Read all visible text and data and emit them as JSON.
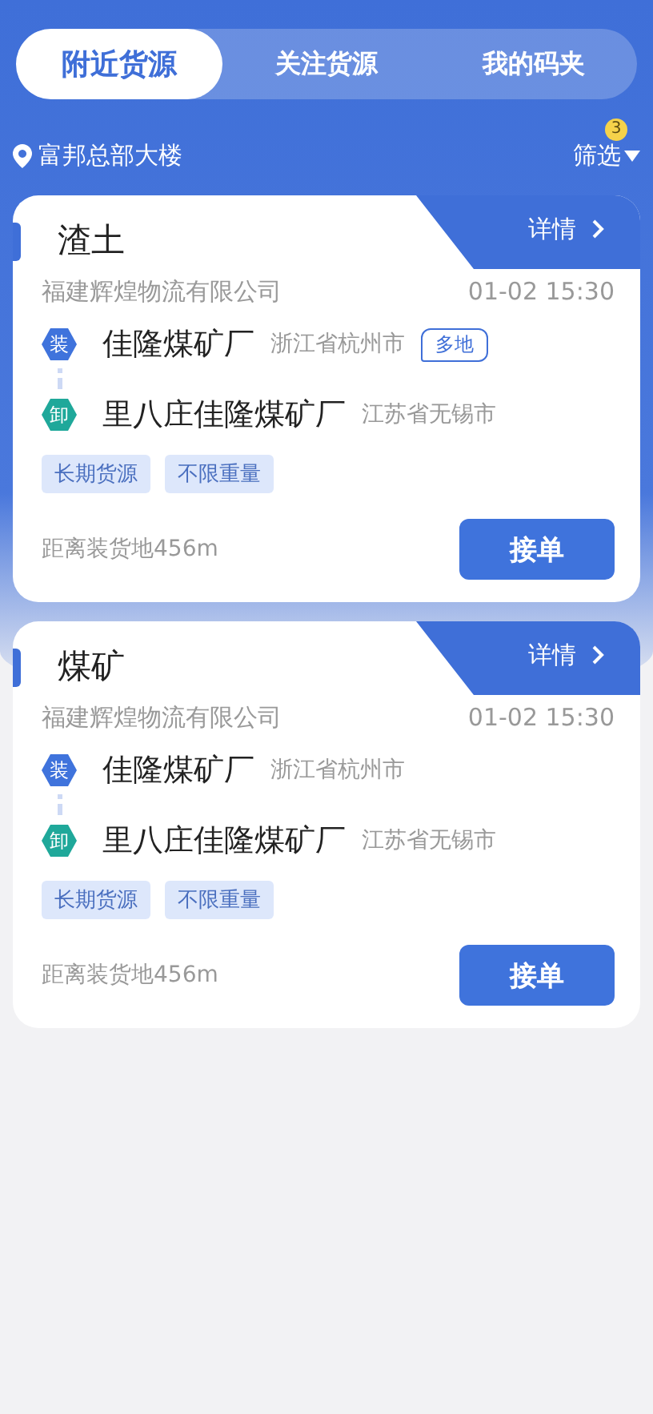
{
  "tabs": [
    {
      "label": "附近货源",
      "selected": true
    },
    {
      "label": "关注货源",
      "selected": false
    },
    {
      "label": "我的码夹",
      "selected": false
    }
  ],
  "location": "富邦总部大楼",
  "filter": {
    "label": "筛选",
    "badge": "3"
  },
  "cards": [
    {
      "title": "渣土",
      "detail": "详情",
      "company": "福建辉煌物流有限公司",
      "time": "01-02 15:30",
      "stops": [
        {
          "kind": "load",
          "mark": "装",
          "name": "佳隆煤矿厂",
          "place": "浙江省杭州市",
          "tag": "多地"
        },
        {
          "kind": "unload",
          "mark": "卸",
          "name": "里八庄佳隆煤矿厂",
          "place": "江苏省无锡市"
        }
      ],
      "tags": [
        "长期货源",
        "不限重量"
      ],
      "distance": "距离装货地456m",
      "action": "接单"
    },
    {
      "title": "煤矿",
      "detail": "详情",
      "company": "福建辉煌物流有限公司",
      "time": "01-02 15:30",
      "stops": [
        {
          "kind": "load",
          "mark": "装",
          "name": "佳隆煤矿厂",
          "place": "浙江省杭州市"
        },
        {
          "kind": "unload",
          "mark": "卸",
          "name": "里八庄佳隆煤矿厂",
          "place": "江苏省无锡市"
        }
      ],
      "tags": [
        "长期货源",
        "不限重量"
      ],
      "distance": "距离装货地456m",
      "action": "接单"
    }
  ]
}
